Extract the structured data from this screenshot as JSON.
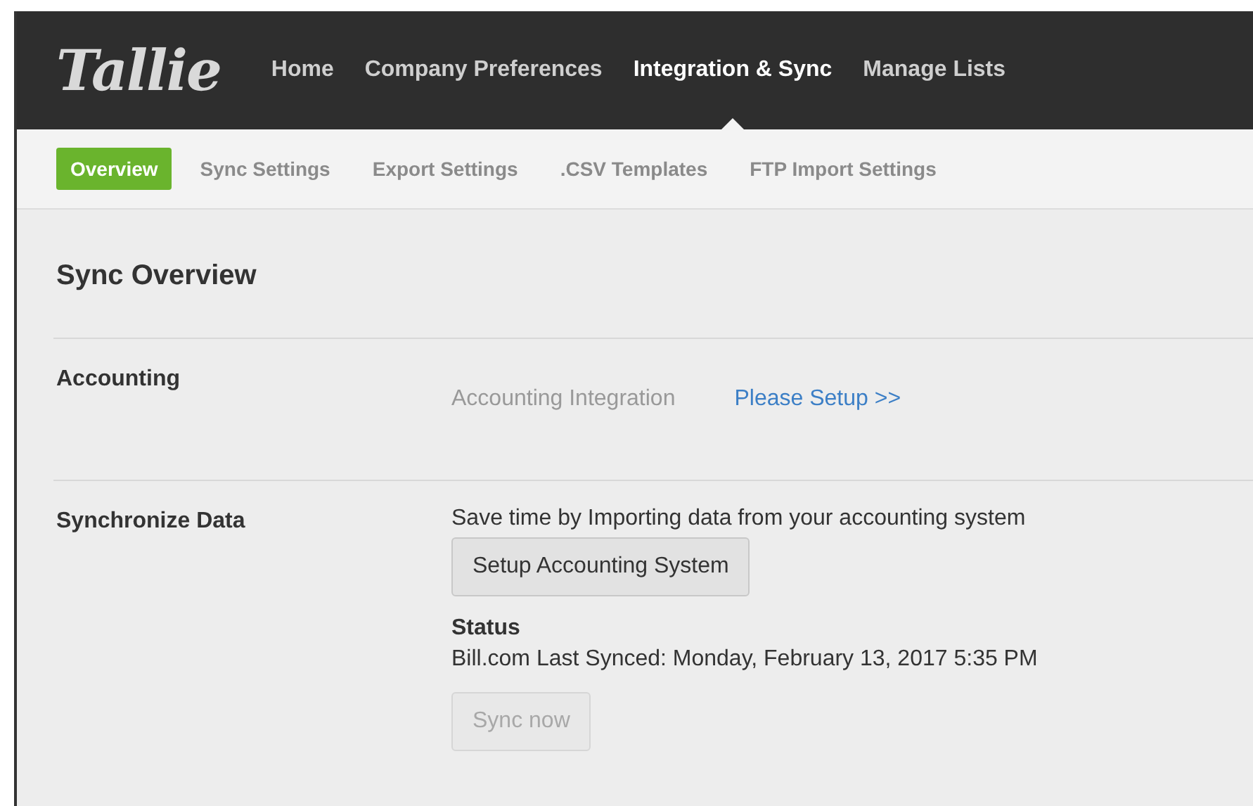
{
  "logo": "Tallie",
  "main_nav": [
    {
      "label": "Home",
      "selected": false
    },
    {
      "label": "Company Preferences",
      "selected": false
    },
    {
      "label": "Integration & Sync",
      "selected": true
    },
    {
      "label": "Manage Lists",
      "selected": false
    }
  ],
  "sub_nav": [
    {
      "label": "Overview",
      "selected": true
    },
    {
      "label": "Sync Settings",
      "selected": false
    },
    {
      "label": "Export Settings",
      "selected": false
    },
    {
      "label": ".CSV Templates",
      "selected": false
    },
    {
      "label": "FTP Import Settings",
      "selected": false
    }
  ],
  "page_title": "Sync Overview",
  "accounting": {
    "label": "Accounting",
    "integration_label": "Accounting Integration",
    "setup_link": "Please Setup >>"
  },
  "synchronize": {
    "label": "Synchronize Data",
    "description": "Save time by Importing data from your accounting system",
    "setup_button": {
      "label": "Setup Accounting System",
      "disabled": false
    },
    "status_heading": "Status",
    "status_text": "Bill.com Last Synced: Monday, February 13, 2017 5:35 PM",
    "sync_button": {
      "label": "Sync now",
      "disabled": true
    }
  }
}
